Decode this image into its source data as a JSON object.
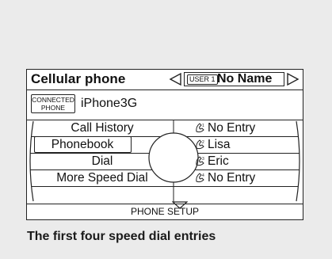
{
  "header": {
    "title": "Cellular phone",
    "user_tag": "USER 1",
    "user_name": "No Name",
    "prev_icon": "triangle-left-icon",
    "next_icon": "triangle-right-icon"
  },
  "connection": {
    "badge_line1": "CONNECTED",
    "badge_line2": "PHONE",
    "device_name": "iPhone3G"
  },
  "menu": {
    "items": [
      {
        "label": "Call History"
      },
      {
        "label": "Phonebook",
        "selected": true
      },
      {
        "label": "Dial"
      },
      {
        "label": "More Speed Dial"
      }
    ]
  },
  "speed_dial": {
    "entries": [
      {
        "icon": "handset-1-icon",
        "label": "No Entry"
      },
      {
        "icon": "handset-2-icon",
        "label": "Lisa"
      },
      {
        "icon": "handset-3-icon",
        "label": "Eric"
      },
      {
        "icon": "handset-4-icon",
        "label": "No Entry"
      }
    ]
  },
  "footer": {
    "label": "PHONE SETUP",
    "scroll_icon": "chevron-down-icon"
  },
  "caption": "The first four speed dial entries"
}
